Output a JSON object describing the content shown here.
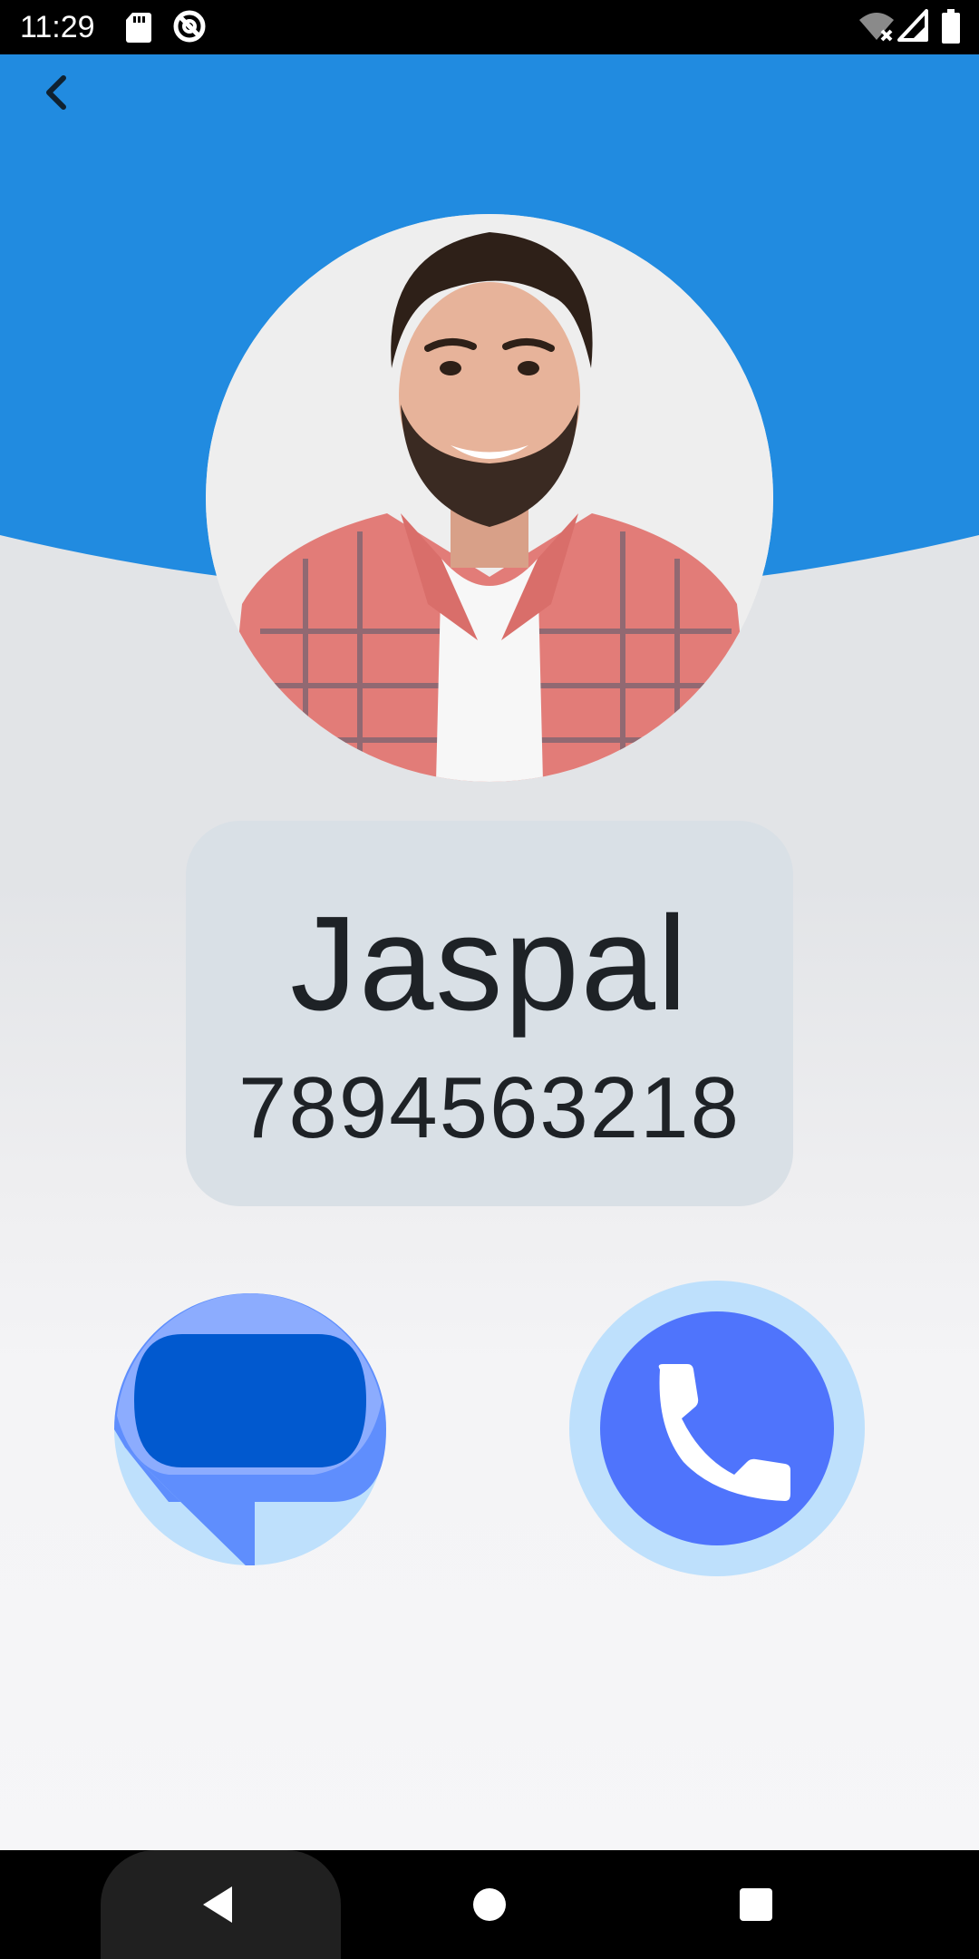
{
  "status_bar": {
    "time": "11:29",
    "icons": [
      "sd-card-icon",
      "sync-icon",
      "wifi-off-icon",
      "signal-icon",
      "battery-icon"
    ]
  },
  "header": {
    "back_icon": "chevron-left-icon",
    "color": "#218be0"
  },
  "contact": {
    "avatar": "contact-photo",
    "name": "Jaspal",
    "number": "7894563218"
  },
  "actions": {
    "message_icon": "message-bubble-icon",
    "call_icon": "phone-icon"
  },
  "nav_bar": {
    "back_icon": "nav-back-icon",
    "home_icon": "nav-home-icon",
    "recents_icon": "nav-recents-icon"
  },
  "colors": {
    "header_blue": "#218be0",
    "card_bg": "#d9e0e6",
    "call_blue": "#4f74fc",
    "halo_blue": "#bee0fc",
    "message_dark": "#0159cf",
    "message_mid": "#5f8efd",
    "message_light": "#8cacfe"
  }
}
